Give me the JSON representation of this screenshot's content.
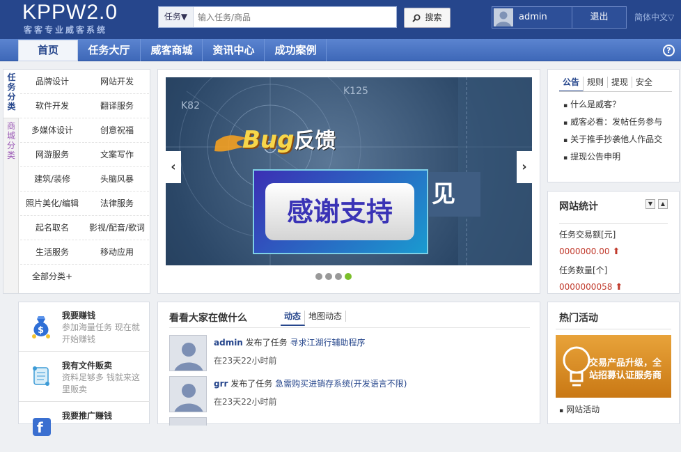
{
  "header": {
    "logo": "KPPW2.0",
    "slogan": "客客专业威客系统",
    "search_type": "任务▼",
    "search_placeholder": "输入任务/商品",
    "search_button": "搜索",
    "username": "admin",
    "logout": "退出",
    "language": "简体中文▽"
  },
  "nav": {
    "items": [
      "首页",
      "任务大厅",
      "威客商城",
      "资讯中心",
      "成功案例"
    ],
    "help": "?"
  },
  "categories": {
    "tabs": [
      "任务分类",
      "商城分类"
    ],
    "items": [
      "品牌设计",
      "网站开发",
      "软件开发",
      "翻译服务",
      "多媒体设计",
      "创意祝福",
      "网游服务",
      "文案写作",
      "建筑/装修",
      "头脑风暴",
      "照片美化/编辑",
      "法律服务",
      "起名取名",
      "影视/配音/歌词",
      "生活服务",
      "移动应用",
      "全部分类+"
    ]
  },
  "banner": {
    "bug_word": "Bug",
    "feedback": "反馈",
    "thanks": "感谢支持",
    "jian": "见",
    "prev": "‹",
    "next": "›",
    "active_slide": 4,
    "slide_count": 4
  },
  "notice": {
    "tabs": [
      "公告",
      "规则",
      "提现",
      "安全"
    ],
    "items": [
      "什么是威客？",
      "威客必看：发帖任务参与",
      "关于推手抄袭他人作品交",
      "提现公告申明"
    ]
  },
  "stats": {
    "title": "网站统计",
    "trade_label": "任务交易额[元]",
    "trade_value": "0000000.00",
    "count_label": "任务数量[个]",
    "count_value": "0000000058",
    "up_arrow": "⬆"
  },
  "earn": [
    {
      "title": "我要赚钱",
      "desc": "参加海量任务 现在就开始赚钱",
      "icon": "money-bag-icon"
    },
    {
      "title": "我有文件贩卖",
      "desc": "资料足够多 钱就来这里贩卖",
      "icon": "scroll-icon"
    },
    {
      "title": "我要推广赚钱",
      "desc": "",
      "icon": "promote-icon"
    }
  ],
  "feed": {
    "title": "看看大家在做什么",
    "tabs": [
      "动态",
      "地图动态"
    ],
    "items": [
      {
        "user": "admin",
        "action": " 发布了任务 ",
        "task": "寻求江湖行辅助程序",
        "time": "在23天22小时前"
      },
      {
        "user": "grr",
        "action": " 发布了任务 ",
        "task": "急需购买进销存系统(开发语言不限)",
        "time": "在23天22小时前"
      }
    ]
  },
  "activity": {
    "title": "热门活动",
    "banner_text": "交易产品升级，全站招募认证服务商",
    "link": "网站活动"
  },
  "colors": {
    "header_bg": "#26468c",
    "nav_bg": "#4a74c4",
    "accent": "#26468c",
    "stat_red": "#c0392b"
  }
}
